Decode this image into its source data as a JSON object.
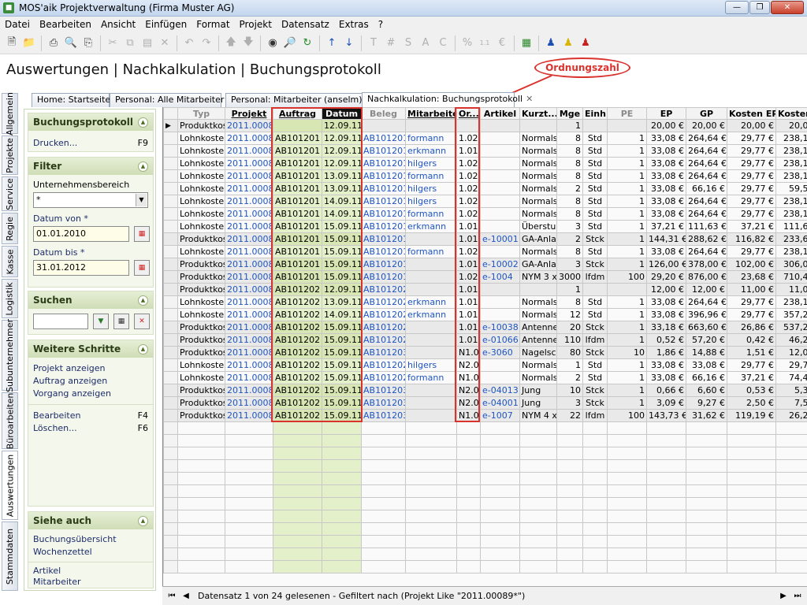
{
  "window": {
    "title": "MOS'aik Projektverwaltung (Firma Muster AG)"
  },
  "menu": [
    "Datei",
    "Bearbeiten",
    "Ansicht",
    "Einfügen",
    "Format",
    "Projekt",
    "Datensatz",
    "Extras",
    "?"
  ],
  "page_title": "Auswertungen | Nachkalkulation | Buchungsprotokoll",
  "callout": "Ordnungszahl",
  "tabs": [
    {
      "label": "Home: Startseite"
    },
    {
      "label": "Personal: Alle Mitarbeiter"
    },
    {
      "label": "Personal: Mitarbeiter (anselm)"
    },
    {
      "label": "Nachkalkulation: Buchungsprotokoll"
    }
  ],
  "vertical_tabs": [
    "Allgemein",
    "Projekte",
    "Service",
    "Regie",
    "Kasse",
    "Logistik",
    "Subunternehmer",
    "Büroarbeiten",
    "Auswertungen",
    "Stammdaten"
  ],
  "sidebar": {
    "buchungsprotokoll": {
      "title": "Buchungsprotokoll",
      "print_label": "Drucken...",
      "print_key": "F9"
    },
    "filter": {
      "title": "Filter",
      "unternehmensbereich_label": "Unternehmensbereich",
      "unternehmensbereich_value": "*",
      "datum_von_label": "Datum von *",
      "datum_von_value": "01.01.2010",
      "datum_bis_label": "Datum bis *",
      "datum_bis_value": "31.01.2012"
    },
    "suchen": {
      "title": "Suchen",
      "value": ""
    },
    "weitere": {
      "title": "Weitere Schritte",
      "links": [
        "Projekt anzeigen",
        "Auftrag anzeigen",
        "Vorgang anzeigen"
      ],
      "edit_label": "Bearbeiten",
      "edit_key": "F4",
      "delete_label": "Löschen...",
      "delete_key": "F6"
    },
    "siehe": {
      "title": "Siehe auch",
      "links": [
        "Buchungsübersicht",
        "Wochenzettel",
        "Artikel",
        "Mitarbeiter"
      ]
    }
  },
  "grid": {
    "columns": [
      "Typ",
      "Projekt",
      "Auftrag",
      "Datum",
      "Beleg",
      "Mitarbeiter",
      "Or...",
      "Artikel",
      "Kurzt...",
      "Mge",
      "Einh",
      "PE",
      "EP",
      "GP",
      "Kosten EP",
      "Kosten GP"
    ],
    "rows": [
      [
        "Produktkosten",
        "2011.00089",
        "",
        "12.09.11",
        "",
        "",
        "",
        "",
        "",
        "1",
        "",
        "",
        "20,00 €",
        "20,00 €",
        "20,00 €",
        "20,00 €"
      ],
      [
        "Lohnkosten",
        "2011.00089",
        "AB101201",
        "12.09.11",
        "AB101201",
        "formann",
        "1.02",
        "",
        "Normalst",
        "8",
        "Std",
        "1",
        "33,08 €",
        "264,64 €",
        "29,77 €",
        "238,16 €"
      ],
      [
        "Lohnkosten",
        "2011.00089",
        "AB101201",
        "12.09.11",
        "AB101201",
        "erkmann",
        "1.01",
        "",
        "Normalst",
        "8",
        "Std",
        "1",
        "33,08 €",
        "264,64 €",
        "29,77 €",
        "238,16 €"
      ],
      [
        "Lohnkosten",
        "2011.00089",
        "AB101201",
        "12.09.11",
        "AB101201",
        "hilgers",
        "1.02",
        "",
        "Normalst",
        "8",
        "Std",
        "1",
        "33,08 €",
        "264,64 €",
        "29,77 €",
        "238,16 €"
      ],
      [
        "Lohnkosten",
        "2011.00089",
        "AB101201",
        "13.09.11",
        "AB101201",
        "formann",
        "1.02",
        "",
        "Normalst",
        "8",
        "Std",
        "1",
        "33,08 €",
        "264,64 €",
        "29,77 €",
        "238,16 €"
      ],
      [
        "Lohnkosten",
        "2011.00089",
        "AB101201",
        "13.09.11",
        "AB101201",
        "hilgers",
        "1.02",
        "",
        "Normalst",
        "2",
        "Std",
        "1",
        "33,08 €",
        "66,16 €",
        "29,77 €",
        "59,54 €"
      ],
      [
        "Lohnkosten",
        "2011.00089",
        "AB101201",
        "14.09.11",
        "AB101201",
        "hilgers",
        "1.02",
        "",
        "Normalst",
        "8",
        "Std",
        "1",
        "33,08 €",
        "264,64 €",
        "29,77 €",
        "238,16 €"
      ],
      [
        "Lohnkosten",
        "2011.00089",
        "AB101201",
        "14.09.11",
        "AB101201",
        "formann",
        "1.02",
        "",
        "Normalst",
        "8",
        "Std",
        "1",
        "33,08 €",
        "264,64 €",
        "29,77 €",
        "238,16 €"
      ],
      [
        "Lohnkosten",
        "2011.00089",
        "AB101201",
        "15.09.11",
        "AB101201",
        "erkmann",
        "1.01",
        "",
        "Überstu",
        "3",
        "Std",
        "1",
        "37,21 €",
        "111,63 €",
        "37,21 €",
        "111,63 €"
      ],
      [
        "Produktkosten",
        "2011.00089",
        "AB101201",
        "15.09.11",
        "AB101201",
        "",
        "1.01",
        "e-10001",
        "GA-Anla",
        "2",
        "Stck",
        "1",
        "144,31 €",
        "288,62 €",
        "116,82 €",
        "233,64 €"
      ],
      [
        "Lohnkosten",
        "2011.00089",
        "AB101201",
        "15.09.11",
        "AB101201",
        "formann",
        "1.02",
        "",
        "Normalst",
        "8",
        "Std",
        "1",
        "33,08 €",
        "264,64 €",
        "29,77 €",
        "238,16 €"
      ],
      [
        "Produktkosten",
        "2011.00089",
        "AB101201",
        "15.09.11",
        "AB101201",
        "",
        "1.01",
        "e-10002",
        "GA-Anla",
        "3",
        "Stck",
        "1",
        "126,00 €",
        "378,00 €",
        "102,00 €",
        "306,00 €"
      ],
      [
        "Produktkosten",
        "2011.00089",
        "AB101201",
        "15.09.11",
        "AB101201",
        "",
        "1.02",
        "e-1004",
        "NYM 3 x",
        "3000",
        "lfdm",
        "100",
        "29,20 €",
        "876,00 €",
        "23,68 €",
        "710,40 €"
      ],
      [
        "Produktkosten",
        "2011.00089",
        "AB101202",
        "12.09.11",
        "AB101202",
        "",
        "1.01",
        "",
        "",
        "1",
        "",
        "",
        "12,00 €",
        "12,00 €",
        "11,00 €",
        "11,00 €"
      ],
      [
        "Lohnkosten",
        "2011.00089",
        "AB101202",
        "13.09.11",
        "AB101202",
        "erkmann",
        "1.01",
        "",
        "Normalst",
        "8",
        "Std",
        "1",
        "33,08 €",
        "264,64 €",
        "29,77 €",
        "238,16 €"
      ],
      [
        "Lohnkosten",
        "2011.00089",
        "AB101202",
        "14.09.11",
        "AB101202",
        "erkmann",
        "1.01",
        "",
        "Normalst",
        "12",
        "Std",
        "1",
        "33,08 €",
        "396,96 €",
        "29,77 €",
        "357,24 €"
      ],
      [
        "Produktkosten",
        "2011.00089",
        "AB101202",
        "15.09.11",
        "AB101202",
        "",
        "1.01",
        "e-10038",
        "Antenne",
        "20",
        "Stck",
        "1",
        "33,18 €",
        "663,60 €",
        "26,86 €",
        "537,20 €"
      ],
      [
        "Produktkosten",
        "2011.00089",
        "AB101202",
        "15.09.11",
        "AB101202",
        "",
        "1.01",
        "e-01066",
        "Antenne",
        "110",
        "lfdm",
        "1",
        "0,52 €",
        "57,20 €",
        "0,42 €",
        "46,20 €"
      ],
      [
        "Produktkosten",
        "2011.00089",
        "AB101202",
        "15.09.11",
        "AB101203",
        "",
        "N1.0",
        "e-3060",
        "Nagelsc",
        "80",
        "Stck",
        "10",
        "1,86 €",
        "14,88 €",
        "1,51 €",
        "12,08 €"
      ],
      [
        "Lohnkosten",
        "2011.00089",
        "AB101202",
        "15.09.11",
        "AB101202",
        "hilgers",
        "N2.0",
        "",
        "Normalst",
        "1",
        "Std",
        "1",
        "33,08 €",
        "33,08 €",
        "29,77 €",
        "29,77 €"
      ],
      [
        "Lohnkosten",
        "2011.00089",
        "AB101202",
        "15.09.11",
        "AB101202",
        "formann",
        "N1.0",
        "",
        "Normalst",
        "2",
        "Std",
        "1",
        "33,08 €",
        "66,16 €",
        "37,21 €",
        "74,42 €"
      ],
      [
        "Produktkosten",
        "2011.00089",
        "AB101202",
        "15.09.11",
        "AB101203",
        "",
        "N2.0",
        "e-04013",
        "Jung",
        "10",
        "Stck",
        "1",
        "0,66 €",
        "6,60 €",
        "0,53 €",
        "5,30 €"
      ],
      [
        "Produktkosten",
        "2011.00089",
        "AB101202",
        "15.09.11",
        "AB101203",
        "",
        "N2.0",
        "e-04001",
        "Jung",
        "3",
        "Stck",
        "1",
        "3,09 €",
        "9,27 €",
        "2,50 €",
        "7,50 €"
      ],
      [
        "Produktkosten",
        "2011.00089",
        "AB101202",
        "15.09.11",
        "AB101203",
        "",
        "N1.0",
        "e-1007",
        "NYM 4 x",
        "22",
        "lfdm",
        "100",
        "143,73 €",
        "31,62 €",
        "119,19 €",
        "26,22 €"
      ]
    ]
  },
  "status": {
    "text": "Datensatz 1 von 24 gelesenen - Gefiltert nach (Projekt Like \"2011.00089*\")"
  }
}
